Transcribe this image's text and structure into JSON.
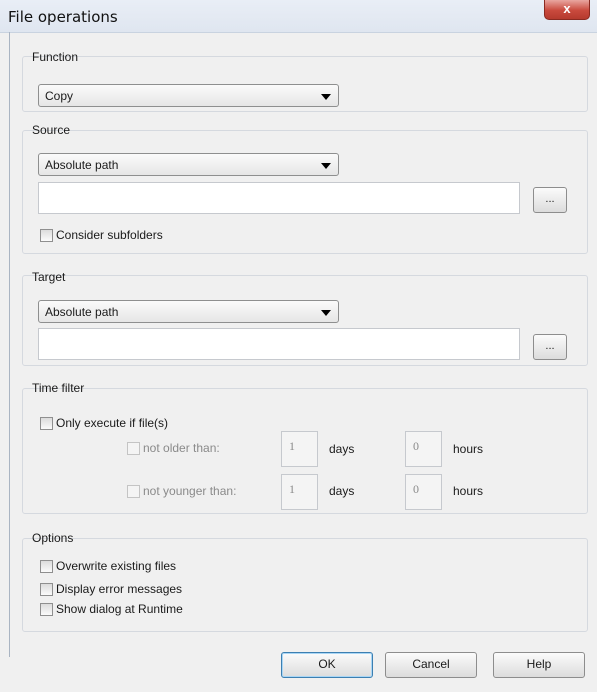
{
  "window": {
    "title": "File operations",
    "close_label": "x"
  },
  "function": {
    "group_label": "Function",
    "selected": "Copy"
  },
  "source": {
    "group_label": "Source",
    "selected": "Absolute path",
    "path_value": "",
    "browse_label": "...",
    "subfolders_label": "Consider subfolders",
    "subfolders_checked": false
  },
  "target": {
    "group_label": "Target",
    "selected": "Absolute path",
    "path_value": "",
    "browse_label": "..."
  },
  "time_filter": {
    "group_label": "Time filter",
    "only_execute_label": "Only execute if file(s)",
    "not_older_label": "not older than:",
    "not_older_days": "1",
    "not_older_hours": "0",
    "not_younger_label": "not younger than:",
    "not_younger_days": "1",
    "not_younger_hours": "0",
    "days_label": "days",
    "hours_label": "hours"
  },
  "options": {
    "group_label": "Options",
    "overwrite_label": "Overwrite existing files",
    "display_errors_label": "Display error messages",
    "show_dialog_label": "Show dialog at Runtime"
  },
  "buttons": {
    "ok": "OK",
    "cancel": "Cancel",
    "help": "Help"
  },
  "colors": {
    "close_button": "#c94a3d",
    "default_button_border": "#3c7fb1"
  }
}
